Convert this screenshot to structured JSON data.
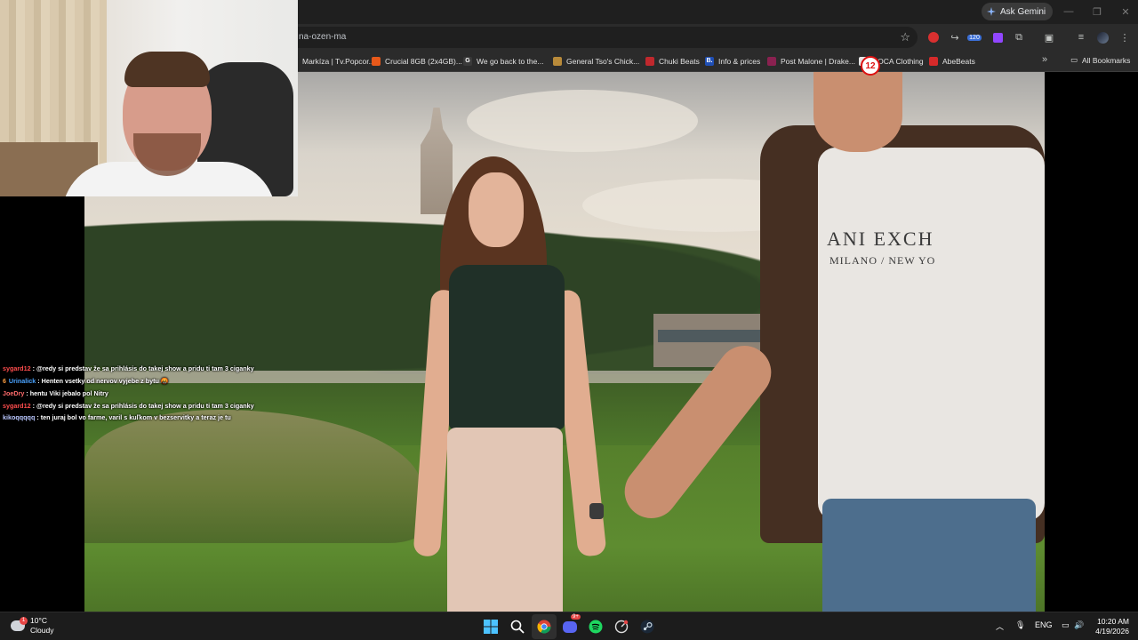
{
  "browser": {
    "ask_gemini": "Ask Gemini",
    "address": "na-ozen-ma",
    "extension_badge": "120",
    "bookmarks": [
      {
        "label": "Markíza | Tv.Popcor...",
        "color": "#2d2d2d"
      },
      {
        "label": "Crucial 8GB (2x4GB)...",
        "color": "#e8591a"
      },
      {
        "label": "We go back to the...",
        "color": "#3a3a3a"
      },
      {
        "label": "General Tso's Chick...",
        "color": "#b88a3a"
      },
      {
        "label": "Chuki Beats",
        "color": "#c0282d"
      },
      {
        "label": "Info & prices",
        "color": "#1f4fb5"
      },
      {
        "label": "Post Malone | Drake...",
        "color": "#8a2150"
      },
      {
        "label": "COCA Clothing",
        "color": "#e5e5e5"
      },
      {
        "label": "AbeBeats",
        "color": "#d62a2a"
      }
    ],
    "all_bookmarks": "All Bookmarks"
  },
  "video": {
    "channel_logo": "12",
    "shirt_text_line1": "ANI EXCH",
    "shirt_text_line2": "MILANO / NEW YO"
  },
  "chat": [
    {
      "user": "sygard12",
      "user_color": "#ff4d4d",
      "badge": "",
      "message": " : @redy si predstav že sa prihlásis do takej show a pridu ti tam 3 ciganky"
    },
    {
      "user": "Urinalick",
      "user_color": "#4aa3ff",
      "badge": "6",
      "message": " : Henten vsetky od nervov vyjebe z bytu 🤬"
    },
    {
      "user": "JoeDry",
      "user_color": "#ff6b6b",
      "badge": "",
      "message": " : hentu Viki jebalo pol Nitry"
    },
    {
      "user": "sygard12",
      "user_color": "#ff4d4d",
      "badge": "",
      "message": " : @redy si predstav že sa prihlásis do takej show a pridu ti tam 3 ciganky"
    },
    {
      "user": "kikoqqqqq",
      "user_color": "#b9c7ff",
      "badge": "",
      "message": " : ten juraj bol vo farme, varil s kuľkom v bezservitky a teraz je tu"
    }
  ],
  "taskbar": {
    "weather_temp": "10°C",
    "weather_desc": "Cloudy",
    "weather_badge": "1",
    "discord_badge": "9+",
    "lang": "ENG",
    "time": "10:20 AM",
    "date": "4/19/2026"
  }
}
